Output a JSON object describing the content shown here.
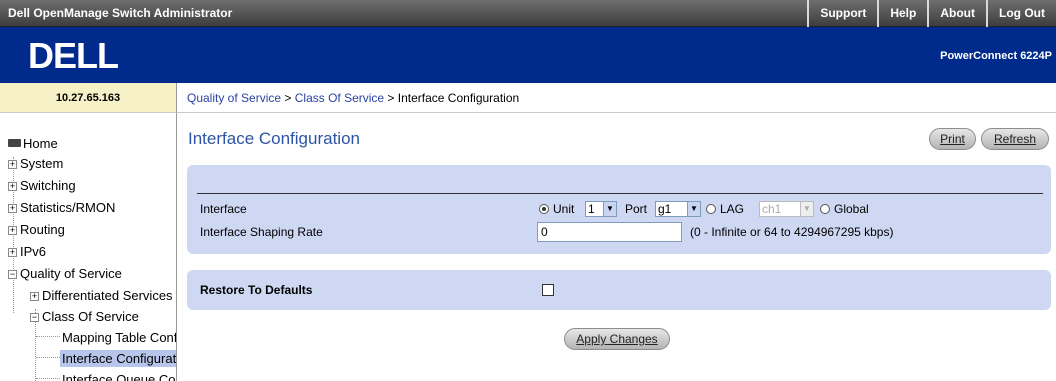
{
  "app": {
    "title": "Dell OpenManage Switch Administrator",
    "links": [
      "Support",
      "Help",
      "About",
      "Log Out"
    ]
  },
  "banner": {
    "logo_text": "DELL",
    "model": "PowerConnect 6224P"
  },
  "ip_address": "10.27.65.163",
  "breadcrumb": {
    "parts": [
      "Quality of Service",
      "Class Of Service"
    ],
    "separator": " > ",
    "current": "Interface Configuration"
  },
  "sidebar": {
    "home": "Home",
    "system": "System",
    "switching": "Switching",
    "stats": "Statistics/RMON",
    "routing": "Routing",
    "ipv6": "IPv6",
    "qos": "Quality of Service",
    "diffserv": "Differentiated Services",
    "cos": "Class Of Service",
    "mapping": "Mapping Table Configuration",
    "intf_config": "Interface Configuration",
    "intf_queue": "Interface Queue Configuration"
  },
  "page": {
    "title": "Interface Configuration",
    "print_label": "Print",
    "refresh_label": "Refresh",
    "interface_label": "Interface",
    "unit_label": "Unit",
    "unit_value": "1",
    "port_label": "Port",
    "port_value": "g1",
    "lag_label": "LAG",
    "lag_value": "ch1",
    "global_label": "Global",
    "selected_scope": "Unit",
    "shaping_label": "Interface Shaping Rate",
    "shaping_value": "0",
    "shaping_hint": "(0 - Infinite or 64 to 4294967295 kbps)",
    "restore_label": "Restore To Defaults",
    "restore_checked": false,
    "apply_label": "Apply Changes"
  },
  "colors": {
    "banner": "#002a8c",
    "panel": "#ced8f3",
    "title": "#2c54a6",
    "link": "#2a43a5"
  }
}
